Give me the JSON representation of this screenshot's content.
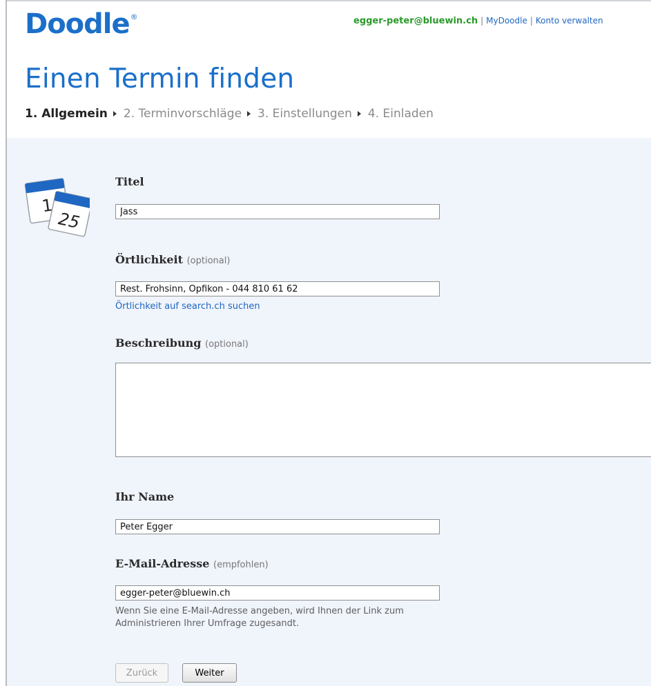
{
  "header": {
    "logo": "Doodle",
    "logo_mark": "®",
    "user_email": "egger-peter@bluewin.ch",
    "links": [
      "MyDoodle",
      "Konto verwalten"
    ]
  },
  "page_title": "Einen Termin finden",
  "steps": [
    {
      "label": "1. Allgemein",
      "active": true
    },
    {
      "label": "2. Terminvorschläge",
      "active": false
    },
    {
      "label": "3. Einstellungen",
      "active": false
    },
    {
      "label": "4. Einladen",
      "active": false
    }
  ],
  "form": {
    "titel": {
      "label": "Titel",
      "value": "Jass"
    },
    "ort": {
      "label": "Örtlichkeit",
      "optional": "(optional)",
      "value": "Rest. Frohsinn, Opfikon - 044 810 61 62",
      "search_link": "Örtlichkeit auf search.ch suchen"
    },
    "beschreibung": {
      "label": "Beschreibung",
      "optional": "(optional)",
      "value": ""
    },
    "name": {
      "label": "Ihr Name",
      "value": "Peter Egger"
    },
    "email": {
      "label": "E-Mail-Adresse",
      "optional": "(empfohlen)",
      "value": "egger-peter@bluewin.ch",
      "hint": "Wenn Sie eine E-Mail-Adresse angeben, wird Ihnen der Link zum Administrieren Ihrer Umfrage zugesandt."
    }
  },
  "buttons": {
    "back": "Zurück",
    "next": "Weiter"
  },
  "calendar_icon": {
    "day1": "1",
    "day2": "25"
  },
  "colors": {
    "brand": "#1b6fc9",
    "email": "#2a9a2a",
    "panel": "#f0f4fb"
  }
}
